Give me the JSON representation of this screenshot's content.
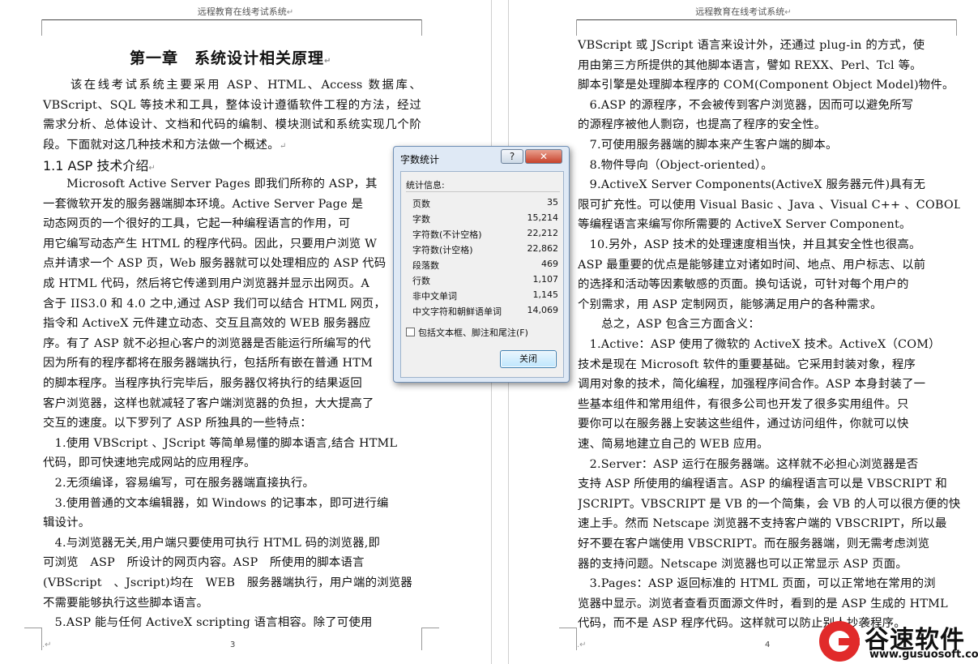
{
  "header_text": "远程教育在线考试系统",
  "left_page": {
    "title": "第一章　系统设计相关原理",
    "intro": "　　该在线考试系统主要采用 ASP、HTML、Access 数据库、VBScript、SQL 等技术和工具，整体设计遵循软件工程的方法，经过需求分析、总体设计、文档和代码的编制、模块测试和系统实现几个阶段。下面就对这几种技术和方法做一个概述。",
    "section": "1.1 ASP 技术介绍",
    "lines": [
      "　　Microsoft Active Server Pages 即我们所称的 ASP，其",
      "一套微软开发的服务器端脚本环境。Active Server Page 是",
      "动态网页的一个很好的工具，它起一种编程语言的作用，可",
      "用它编写动态产生 HTML 的程序代码。因此，只要用户浏览 W",
      "点并请求一个 ASP 页，Web 服务器就可以处理相应的 ASP 代码",
      "成 HTML 代码，然后将它传递到用户浏览器并显示出网页。A",
      "含于 IIS3.0 和 4.0 之中,通过 ASP 我们可以结合 HTML 网页，",
      "指令和 ActiveX 元件建立动态、交互且高效的 WEB 服务器应",
      "序。有了 ASP 就不必担心客户的浏览器是否能运行所编写的代",
      "因为所有的程序都将在服务器端执行，包括所有嵌在普通 HTM",
      "的脚本程序。当程序执行完毕后，服务器仅将执行的结果返回",
      "客户浏览器，这样也就减轻了客户端浏览器的负担，大大提高了",
      "交互的速度。以下罗列了 ASP 所独具的一些特点：",
      "　1.使用 VBScript 、JScript 等简单易懂的脚本语言,结合 HTML",
      "代码，即可快速地完成网站的应用程序。",
      "　2.无须编译，容易编写，可在服务器端直接执行。",
      "　3.使用普通的文本编辑器，如 Windows 的记事本，即可进行编",
      "辑设计。",
      "　4.与浏览器无关,用户端只要使用可执行 HTML 码的浏览器,即",
      "可浏览　ASP　所设计的网页内容。ASP　所使用的脚本语言",
      "(VBScript　、Jscript)均在　WEB　服务器端执行，用户端的浏览器",
      "不需要能够执行这些脚本语言。",
      "　5.ASP 能与任何 ActiveX scripting 语言相容。除了可使用"
    ],
    "page_number": "3"
  },
  "right_page": {
    "lines": [
      "VBScript 或 JScript 语言来设计外，还通过 plug-in 的方式，使",
      "用由第三方所提供的其他脚本语言，譬如 REXX、Perl、Tcl 等。",
      "脚本引擎是处理脚本程序的 COM(Component Object Model)物件。",
      "　6.ASP 的源程序，不会被传到客户浏览器，因而可以避免所写",
      "的源程序被他人剽窃，也提高了程序的安全性。",
      "　7.可使用服务器端的脚本来产生客户端的脚本。",
      "　8.物件导向（Object-oriented）。",
      "　9.ActiveX Server Components(ActiveX 服务器元件)具有无",
      "限可扩充性。可以使用 Visual Basic 、Java 、Visual C++ 、COBOL",
      "等编程语言来编写你所需要的 ActiveX Server Component。",
      "　10.另外，ASP 技术的处理速度相当快，并且其安全性也很高。",
      "ASP 最重要的优点是能够建立对诸如时间、地点、用户标志、以前",
      "的选择和活动等因素敏感的页面。换句话说，可针对每个用户的",
      "个别需求，用 ASP 定制网页，能够满足用户的各种需求。",
      "　　总之，ASP 包含三方面含义：",
      "　1.Active：ASP 使用了微软的 ActiveX 技术。ActiveX（COM）",
      "技术是现在 Microsoft 软件的重要基础。它采用封装对象，程序",
      "调用对象的技术，简化编程，加强程序间合作。ASP 本身封装了一",
      "些基本组件和常用组件，有很多公司也开发了很多实用组件。只",
      "要你可以在服务器上安装这些组件，通过访问组件，你就可以快",
      "速、简易地建立自己的 WEB 应用。",
      "　2.Server：ASP 运行在服务器端。这样就不必担心浏览器是否",
      "支持 ASP 所使用的编程语言。ASP 的编程语言可以是 VBSCRIPT 和",
      "JSCRIPT。VBSCRIPT 是 VB 的一个简集，会 VB 的人可以很方便的快",
      "速上手。然而 Netscape 浏览器不支持客户端的 VBSCRIPT，所以最",
      "好不要在客户端使用 VBSCRIPT。而在服务器端，则无需考虑浏览",
      "器的支持问题。Netscape 浏览器也可以正常显示 ASP 页面。",
      "　3.Pages：ASP 返回标准的 HTML 页面，可以正常地在常用的浏",
      "览器中显示。浏览者查看页面源文件时，看到的是 ASP 生成的 HTML",
      "代码，而不是 ASP 程序代码。这样就可以防止别人抄袭程序。"
    ],
    "page_number": "4"
  },
  "dialog": {
    "title": "字数统计",
    "help_label": "?",
    "close_label": "✕",
    "section_label": "统计信息:",
    "stats": [
      {
        "label": "页数",
        "value": "35"
      },
      {
        "label": "字数",
        "value": "15,214"
      },
      {
        "label": "字符数(不计空格)",
        "value": "22,212"
      },
      {
        "label": "字符数(计空格)",
        "value": "22,862"
      },
      {
        "label": "段落数",
        "value": "469"
      },
      {
        "label": "行数",
        "value": "1,107"
      },
      {
        "label": "非中文单词",
        "value": "1,145"
      },
      {
        "label": "中文字符和朝鲜语单词",
        "value": "14,069"
      }
    ],
    "checkbox_label": "包括文本框、脚注和尾注(F)",
    "checkbox_checked": false,
    "ok_label": "关闭"
  },
  "watermark": {
    "brand": "谷速软件",
    "url": "www.gusuosoft.com"
  }
}
